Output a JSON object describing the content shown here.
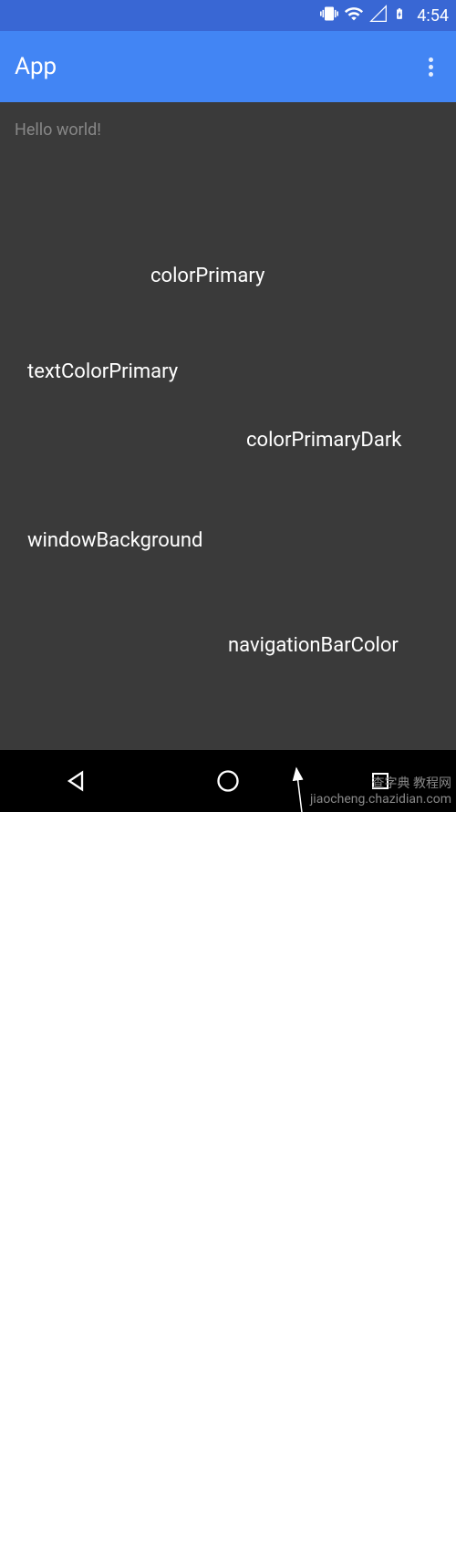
{
  "status_bar": {
    "time": "4:54"
  },
  "app_bar": {
    "title": "App"
  },
  "content": {
    "hello_text": "Hello world!"
  },
  "annotations": {
    "color_primary": "colorPrimary",
    "text_color_primary": "textColorPrimary",
    "color_primary_dark": "colorPrimaryDark",
    "window_background": "windowBackground",
    "navigation_bar_color": "navigationBarColor"
  },
  "colors": {
    "status_bar": "#3967d4",
    "app_bar": "#4285f4",
    "window_bg": "#3a3a3a",
    "nav_bar": "#000000",
    "text_primary": "#ffffff",
    "text_muted": "#888888"
  },
  "watermark": {
    "line1": "查字典",
    "line2": "jiaocheng.chazidian.com"
  }
}
